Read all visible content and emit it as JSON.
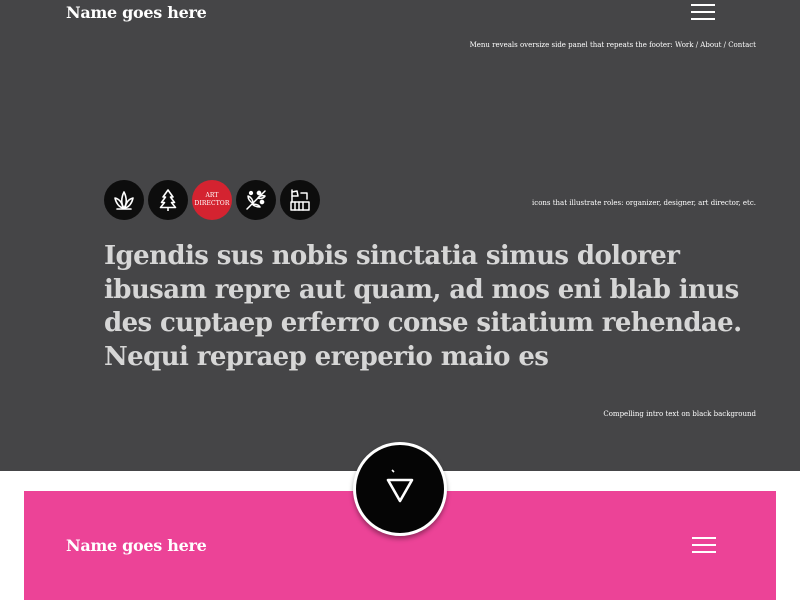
{
  "header": {
    "site_name": "Name goes here",
    "menu_icon": "hamburger-menu-icon",
    "menu_note": "Menu reveals oversize side panel that repeats the footer: Work /  About / Contact"
  },
  "hero": {
    "roles": [
      {
        "icon": "leaf-sprout-icon"
      },
      {
        "icon": "pine-tree-icon"
      },
      {
        "badge_lines": [
          "ART",
          "DIRECTOR"
        ]
      },
      {
        "icon": "olive-branch-icon"
      },
      {
        "icon": "axe-stump-icon"
      }
    ],
    "roles_note": "icons that illustrate roles: organizer, designer, art director, etc.",
    "intro_text": "Igendis sus nobis sinctatia simus dolorer ibusam repre aut quam, ad mos eni blab inus des cuptaep erferro conse sitatium rehendae. Nequi repraep ereperio maio es",
    "intro_note": "Compelling intro text on black background"
  },
  "scroll_button": {
    "icon": "down-triangle-logo-icon"
  },
  "footer": {
    "site_name": "Name goes here",
    "menu_icon": "hamburger-menu-icon"
  },
  "colors": {
    "hero_background": "#454547",
    "footer_background": "#ec4397",
    "badge_red": "#d42330",
    "intro_text": "#d6d6d6"
  }
}
